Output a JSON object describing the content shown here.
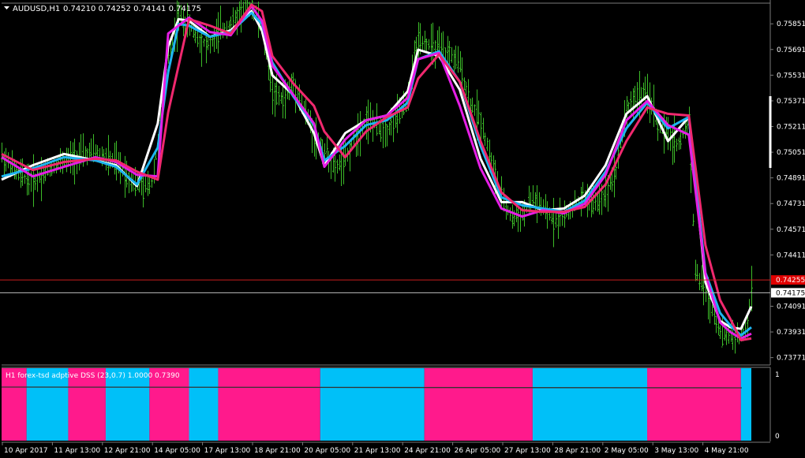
{
  "header": {
    "symbol": "AUDUSD,H1",
    "ohlc": "0.74210 0.74252 0.74141 0.74175"
  },
  "indicator": {
    "title": "H1 forex-tsd adptive DSS (23,0.7) 1.0000 0.7390",
    "scale_top": "1",
    "scale_bottom": "0"
  },
  "colors": {
    "background": "#000000",
    "candles": "#3cbb28",
    "white_line": "#ffffff",
    "blue_line": "#1eb4f0",
    "magenta_line": "#e61ee6",
    "pink_line": "#f0286e",
    "segment_blue": "#00c0f8",
    "segment_pink": "#ff1a8c",
    "bid_line": "#c8c8c8",
    "ask_line": "#c81e1e"
  },
  "chart_data": [
    {
      "type": "line",
      "title": "AUDUSD,H1",
      "y_ticks": [
        0.75851,
        0.75691,
        0.75531,
        0.75371,
        0.75211,
        0.75051,
        0.74891,
        0.74731,
        0.74571,
        0.74411,
        0.74091,
        0.73931,
        0.73771
      ],
      "ylim": [
        0.7373,
        0.7597
      ],
      "x_labels": [
        "10 Apr 2017",
        "11 Apr 13:00",
        "12 Apr 21:00",
        "14 Apr 05:00",
        "17 Apr 13:00",
        "18 Apr 21:00",
        "20 Apr 05:00",
        "21 Apr 13:00",
        "24 Apr 21:00",
        "26 Apr 05:00",
        "27 Apr 13:00",
        "28 Apr 21:00",
        "2 May 05:00",
        "3 May 13:00",
        "4 May 21:00"
      ],
      "price_markers": {
        "ask": "0.74255",
        "bid": "0.74175"
      },
      "price_path": [
        [
          0,
          0.7503
        ],
        [
          8,
          0.7491
        ],
        [
          15,
          0.7487
        ],
        [
          25,
          0.7497
        ],
        [
          35,
          0.7502
        ],
        [
          45,
          0.7505
        ],
        [
          55,
          0.7498
        ],
        [
          62,
          0.7488
        ],
        [
          68,
          0.7482
        ],
        [
          72,
          0.7487
        ],
        [
          75,
          0.7511
        ],
        [
          80,
          0.7566
        ],
        [
          85,
          0.7589
        ],
        [
          90,
          0.7584
        ],
        [
          95,
          0.7575
        ],
        [
          100,
          0.7572
        ],
        [
          105,
          0.7581
        ],
        [
          110,
          0.7585
        ],
        [
          115,
          0.7593
        ],
        [
          120,
          0.7597
        ],
        [
          125,
          0.7581
        ],
        [
          130,
          0.7542
        ],
        [
          135,
          0.7538
        ],
        [
          140,
          0.7548
        ],
        [
          145,
          0.7532
        ],
        [
          150,
          0.7516
        ],
        [
          155,
          0.7506
        ],
        [
          160,
          0.7496
        ],
        [
          165,
          0.75
        ],
        [
          170,
          0.7516
        ],
        [
          175,
          0.7526
        ],
        [
          180,
          0.7521
        ],
        [
          185,
          0.7519
        ],
        [
          190,
          0.7527
        ],
        [
          195,
          0.7537
        ],
        [
          198,
          0.7564
        ],
        [
          200,
          0.7577
        ],
        [
          205,
          0.7572
        ],
        [
          210,
          0.7569
        ],
        [
          215,
          0.7566
        ],
        [
          220,
          0.7559
        ],
        [
          225,
          0.7536
        ],
        [
          230,
          0.7525
        ],
        [
          235,
          0.7499
        ],
        [
          240,
          0.7476
        ],
        [
          245,
          0.7464
        ],
        [
          250,
          0.7466
        ],
        [
          255,
          0.7476
        ],
        [
          260,
          0.7469
        ],
        [
          265,
          0.7463
        ],
        [
          270,
          0.7465
        ],
        [
          275,
          0.7472
        ],
        [
          280,
          0.7477
        ],
        [
          285,
          0.7473
        ],
        [
          290,
          0.748
        ],
        [
          295,
          0.7495
        ],
        [
          298,
          0.752
        ],
        [
          300,
          0.7532
        ],
        [
          305,
          0.754
        ],
        [
          308,
          0.7542
        ],
        [
          312,
          0.7536
        ],
        [
          315,
          0.7522
        ],
        [
          320,
          0.7515
        ],
        [
          325,
          0.751
        ],
        [
          330,
          0.7525
        ],
        [
          333,
          0.7431
        ],
        [
          338,
          0.7418
        ],
        [
          342,
          0.7403
        ],
        [
          346,
          0.739
        ],
        [
          350,
          0.7392
        ],
        [
          355,
          0.7389
        ],
        [
          358,
          0.7397
        ],
        [
          360,
          0.742
        ]
      ],
      "series": [
        {
          "color": "#ffffff",
          "values": [
            [
              0,
              0.7488
            ],
            [
              15,
              0.7497
            ],
            [
              30,
              0.7504
            ],
            [
              45,
              0.75
            ],
            [
              55,
              0.7497
            ],
            [
              65,
              0.7484
            ],
            [
              75,
              0.7523
            ],
            [
              80,
              0.7571
            ],
            [
              85,
              0.7588
            ],
            [
              90,
              0.7587
            ],
            [
              100,
              0.7577
            ],
            [
              110,
              0.7581
            ],
            [
              120,
              0.7593
            ],
            [
              125,
              0.7581
            ],
            [
              130,
              0.7553
            ],
            [
              140,
              0.7541
            ],
            [
              150,
              0.7517
            ],
            [
              155,
              0.7497
            ],
            [
              165,
              0.7517
            ],
            [
              175,
              0.7525
            ],
            [
              185,
              0.7528
            ],
            [
              195,
              0.7543
            ],
            [
              200,
              0.7569
            ],
            [
              210,
              0.7565
            ],
            [
              220,
              0.7544
            ],
            [
              230,
              0.7501
            ],
            [
              240,
              0.7474
            ],
            [
              250,
              0.7474
            ],
            [
              260,
              0.7469
            ],
            [
              270,
              0.747
            ],
            [
              280,
              0.7478
            ],
            [
              290,
              0.7497
            ],
            [
              300,
              0.7529
            ],
            [
              310,
              0.754
            ],
            [
              320,
              0.7512
            ],
            [
              330,
              0.7527
            ],
            [
              338,
              0.7424
            ],
            [
              345,
              0.74
            ],
            [
              350,
              0.7396
            ],
            [
              355,
              0.7395
            ],
            [
              360,
              0.7409
            ]
          ]
        },
        {
          "color": "#1eb4f0",
          "values": [
            [
              0,
              0.749
            ],
            [
              15,
              0.7495
            ],
            [
              30,
              0.7502
            ],
            [
              45,
              0.75
            ],
            [
              55,
              0.7496
            ],
            [
              65,
              0.7485
            ],
            [
              75,
              0.7508
            ],
            [
              80,
              0.7555
            ],
            [
              85,
              0.7585
            ],
            [
              90,
              0.7584
            ],
            [
              100,
              0.7577
            ],
            [
              110,
              0.758
            ],
            [
              120,
              0.7592
            ],
            [
              125,
              0.7585
            ],
            [
              130,
              0.7561
            ],
            [
              140,
              0.754
            ],
            [
              150,
              0.7522
            ],
            [
              155,
              0.75
            ],
            [
              165,
              0.7509
            ],
            [
              175,
              0.7522
            ],
            [
              185,
              0.7525
            ],
            [
              195,
              0.7536
            ],
            [
              200,
              0.7563
            ],
            [
              210,
              0.7568
            ],
            [
              220,
              0.7549
            ],
            [
              230,
              0.7509
            ],
            [
              240,
              0.7477
            ],
            [
              250,
              0.7472
            ],
            [
              260,
              0.747
            ],
            [
              270,
              0.7468
            ],
            [
              280,
              0.7475
            ],
            [
              290,
              0.7493
            ],
            [
              300,
              0.752
            ],
            [
              310,
              0.7536
            ],
            [
              320,
              0.752
            ],
            [
              330,
              0.7527
            ],
            [
              338,
              0.743
            ],
            [
              345,
              0.7405
            ],
            [
              350,
              0.7397
            ],
            [
              355,
              0.7391
            ],
            [
              360,
              0.7396
            ]
          ]
        },
        {
          "color": "#e61ee6",
          "values": [
            [
              0,
              0.7502
            ],
            [
              15,
              0.749
            ],
            [
              30,
              0.7496
            ],
            [
              45,
              0.7502
            ],
            [
              55,
              0.7499
            ],
            [
              65,
              0.7491
            ],
            [
              75,
              0.749
            ],
            [
              80,
              0.7579
            ],
            [
              90,
              0.7589
            ],
            [
              100,
              0.758
            ],
            [
              110,
              0.7578
            ],
            [
              120,
              0.7596
            ],
            [
              125,
              0.7587
            ],
            [
              130,
              0.7559
            ],
            [
              140,
              0.7541
            ],
            [
              150,
              0.7523
            ],
            [
              155,
              0.7496
            ],
            [
              165,
              0.7513
            ],
            [
              175,
              0.7525
            ],
            [
              185,
              0.7528
            ],
            [
              195,
              0.7539
            ],
            [
              200,
              0.7563
            ],
            [
              210,
              0.7567
            ],
            [
              220,
              0.7534
            ],
            [
              230,
              0.7495
            ],
            [
              240,
              0.747
            ],
            [
              250,
              0.7465
            ],
            [
              260,
              0.7469
            ],
            [
              270,
              0.7467
            ],
            [
              280,
              0.7473
            ],
            [
              290,
              0.7491
            ],
            [
              300,
              0.7525
            ],
            [
              310,
              0.7537
            ],
            [
              320,
              0.7522
            ],
            [
              330,
              0.7516
            ],
            [
              338,
              0.7429
            ],
            [
              345,
              0.7399
            ],
            [
              350,
              0.7393
            ],
            [
              355,
              0.7389
            ],
            [
              360,
              0.7392
            ]
          ]
        },
        {
          "color": "#f0286e",
          "values": [
            [
              0,
              0.7504
            ],
            [
              15,
              0.7494
            ],
            [
              30,
              0.7499
            ],
            [
              45,
              0.7501
            ],
            [
              55,
              0.75
            ],
            [
              65,
              0.7493
            ],
            [
              75,
              0.7488
            ],
            [
              80,
              0.753
            ],
            [
              90,
              0.7588
            ],
            [
              100,
              0.7584
            ],
            [
              110,
              0.7579
            ],
            [
              120,
              0.7597
            ],
            [
              125,
              0.7593
            ],
            [
              130,
              0.7565
            ],
            [
              140,
              0.7548
            ],
            [
              150,
              0.7534
            ],
            [
              155,
              0.7518
            ],
            [
              165,
              0.7502
            ],
            [
              175,
              0.7518
            ],
            [
              185,
              0.7527
            ],
            [
              195,
              0.7533
            ],
            [
              200,
              0.7551
            ],
            [
              210,
              0.7566
            ],
            [
              220,
              0.7549
            ],
            [
              230,
              0.7512
            ],
            [
              240,
              0.748
            ],
            [
              250,
              0.7469
            ],
            [
              260,
              0.7468
            ],
            [
              270,
              0.7468
            ],
            [
              280,
              0.7471
            ],
            [
              290,
              0.7485
            ],
            [
              300,
              0.7512
            ],
            [
              310,
              0.7533
            ],
            [
              320,
              0.7529
            ],
            [
              330,
              0.7528
            ],
            [
              338,
              0.7447
            ],
            [
              345,
              0.7413
            ],
            [
              350,
              0.7401
            ],
            [
              355,
              0.7388
            ],
            [
              360,
              0.7389
            ]
          ]
        }
      ]
    },
    {
      "type": "bar",
      "title": "H1 forex-tsd adptive DSS (23,0.7) 1.0000 0.7390",
      "ylim": [
        0,
        1
      ],
      "segments": [
        {
          "x0": 0,
          "x1": 12,
          "color": "pink"
        },
        {
          "x0": 12,
          "x1": 32,
          "color": "blue"
        },
        {
          "x0": 32,
          "x1": 50,
          "color": "pink"
        },
        {
          "x0": 50,
          "x1": 71,
          "color": "blue"
        },
        {
          "x0": 71,
          "x1": 90,
          "color": "pink"
        },
        {
          "x0": 90,
          "x1": 104,
          "color": "blue"
        },
        {
          "x0": 104,
          "x1": 153,
          "color": "pink"
        },
        {
          "x0": 153,
          "x1": 203,
          "color": "blue"
        },
        {
          "x0": 203,
          "x1": 255,
          "color": "pink"
        },
        {
          "x0": 255,
          "x1": 310,
          "color": "blue"
        },
        {
          "x0": 310,
          "x1": 355,
          "color": "pink"
        },
        {
          "x0": 355,
          "x1": 360,
          "color": "blue"
        }
      ]
    }
  ]
}
